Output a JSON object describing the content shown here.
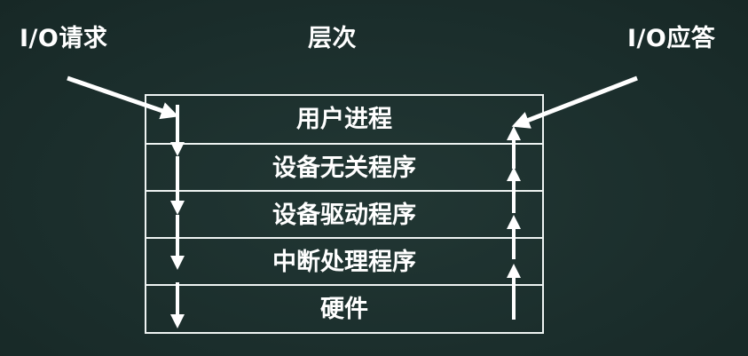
{
  "labels": {
    "request": "I/O请求",
    "title": "层次",
    "response": "I/O应答"
  },
  "layers": [
    {
      "name": "用户进程"
    },
    {
      "name": "设备无关程序"
    },
    {
      "name": "设备驱动程序"
    },
    {
      "name": "中断处理程序"
    },
    {
      "name": "硬件"
    }
  ],
  "colors": {
    "background": "#1b2e2c",
    "foreground": "#ffffff",
    "lines": "#eef3f2"
  }
}
